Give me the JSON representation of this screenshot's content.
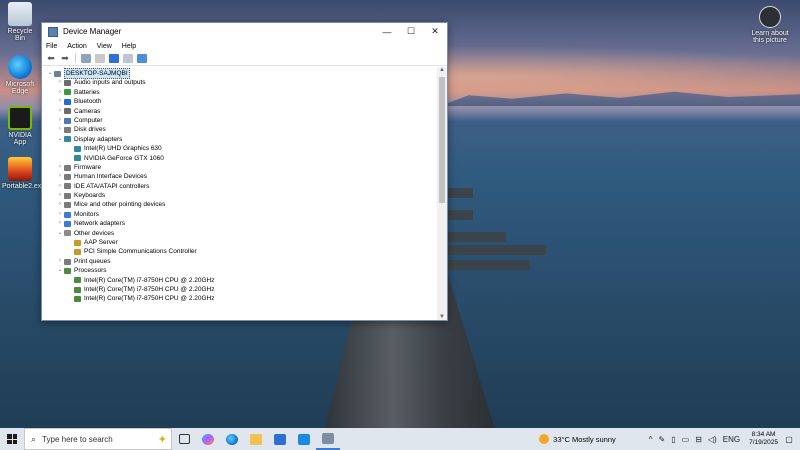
{
  "desktop": {
    "icons": [
      {
        "label": "Recycle Bin"
      },
      {
        "label": "Microsoft Edge"
      },
      {
        "label": "NVIDIA App"
      },
      {
        "label": "Portable2.exe"
      }
    ],
    "learn_label": "Learn about this picture"
  },
  "window": {
    "title": "Device Manager",
    "menu": [
      "File",
      "Action",
      "View",
      "Help"
    ],
    "tree": [
      {
        "label": "DESKTOP-SAJMQBI",
        "level": 0,
        "expander": "⌄",
        "icon_color": "#6a7f9a",
        "root": true
      },
      {
        "label": "Audio inputs and outputs",
        "level": 1,
        "expander": "›",
        "icon_color": "#6b6b6b"
      },
      {
        "label": "Batteries",
        "level": 1,
        "expander": "›",
        "icon_color": "#3c9a3c"
      },
      {
        "label": "Bluetooth",
        "level": 1,
        "expander": "›",
        "icon_color": "#1f6fd1"
      },
      {
        "label": "Cameras",
        "level": 1,
        "expander": "›",
        "icon_color": "#6b6b6b"
      },
      {
        "label": "Computer",
        "level": 1,
        "expander": "›",
        "icon_color": "#4a78b5"
      },
      {
        "label": "Disk drives",
        "level": 1,
        "expander": "›",
        "icon_color": "#7a7a7a"
      },
      {
        "label": "Display adapters",
        "level": 1,
        "expander": "⌄",
        "icon_color": "#2e8b9a"
      },
      {
        "label": "Intel(R) UHD Graphics 630",
        "level": 2,
        "expander": "",
        "icon_color": "#2e8b9a"
      },
      {
        "label": "NVIDIA GeForce GTX 1060",
        "level": 2,
        "expander": "",
        "icon_color": "#2e8b9a"
      },
      {
        "label": "Firmware",
        "level": 1,
        "expander": "›",
        "icon_color": "#7a7a7a"
      },
      {
        "label": "Human Interface Devices",
        "level": 1,
        "expander": "›",
        "icon_color": "#7a7a7a"
      },
      {
        "label": "IDE ATA/ATAPI controllers",
        "level": 1,
        "expander": "›",
        "icon_color": "#7a7a7a"
      },
      {
        "label": "Keyboards",
        "level": 1,
        "expander": "›",
        "icon_color": "#7a7a7a"
      },
      {
        "label": "Mice and other pointing devices",
        "level": 1,
        "expander": "›",
        "icon_color": "#7a7a7a"
      },
      {
        "label": "Monitors",
        "level": 1,
        "expander": "›",
        "icon_color": "#3a7bd5"
      },
      {
        "label": "Network adapters",
        "level": 1,
        "expander": "›",
        "icon_color": "#3a7bd5"
      },
      {
        "label": "Other devices",
        "level": 1,
        "expander": "⌄",
        "icon_color": "#8a8a8a"
      },
      {
        "label": "AAP Server",
        "level": 2,
        "expander": "",
        "icon_color": "#c49a2a"
      },
      {
        "label": "PCI Simple Communications Controller",
        "level": 2,
        "expander": "",
        "icon_color": "#c49a2a"
      },
      {
        "label": "Print queues",
        "level": 1,
        "expander": "›",
        "icon_color": "#7a7a7a"
      },
      {
        "label": "Processors",
        "level": 1,
        "expander": "⌄",
        "icon_color": "#4c8a3c"
      },
      {
        "label": "Intel(R) Core(TM) i7-8750H CPU @ 2.20GHz",
        "level": 2,
        "expander": "",
        "icon_color": "#4c8a3c"
      },
      {
        "label": "Intel(R) Core(TM) i7-8750H CPU @ 2.20GHz",
        "level": 2,
        "expander": "",
        "icon_color": "#4c8a3c"
      },
      {
        "label": "Intel(R) Core(TM) i7-8750H CPU @ 2.20GHz",
        "level": 2,
        "expander": "",
        "icon_color": "#4c8a3c"
      }
    ]
  },
  "taskbar": {
    "search_placeholder": "Type here to search",
    "weather": "33°C  Mostly sunny",
    "language": "ENG",
    "time": "8:34 AM",
    "date": "7/19/2025"
  }
}
